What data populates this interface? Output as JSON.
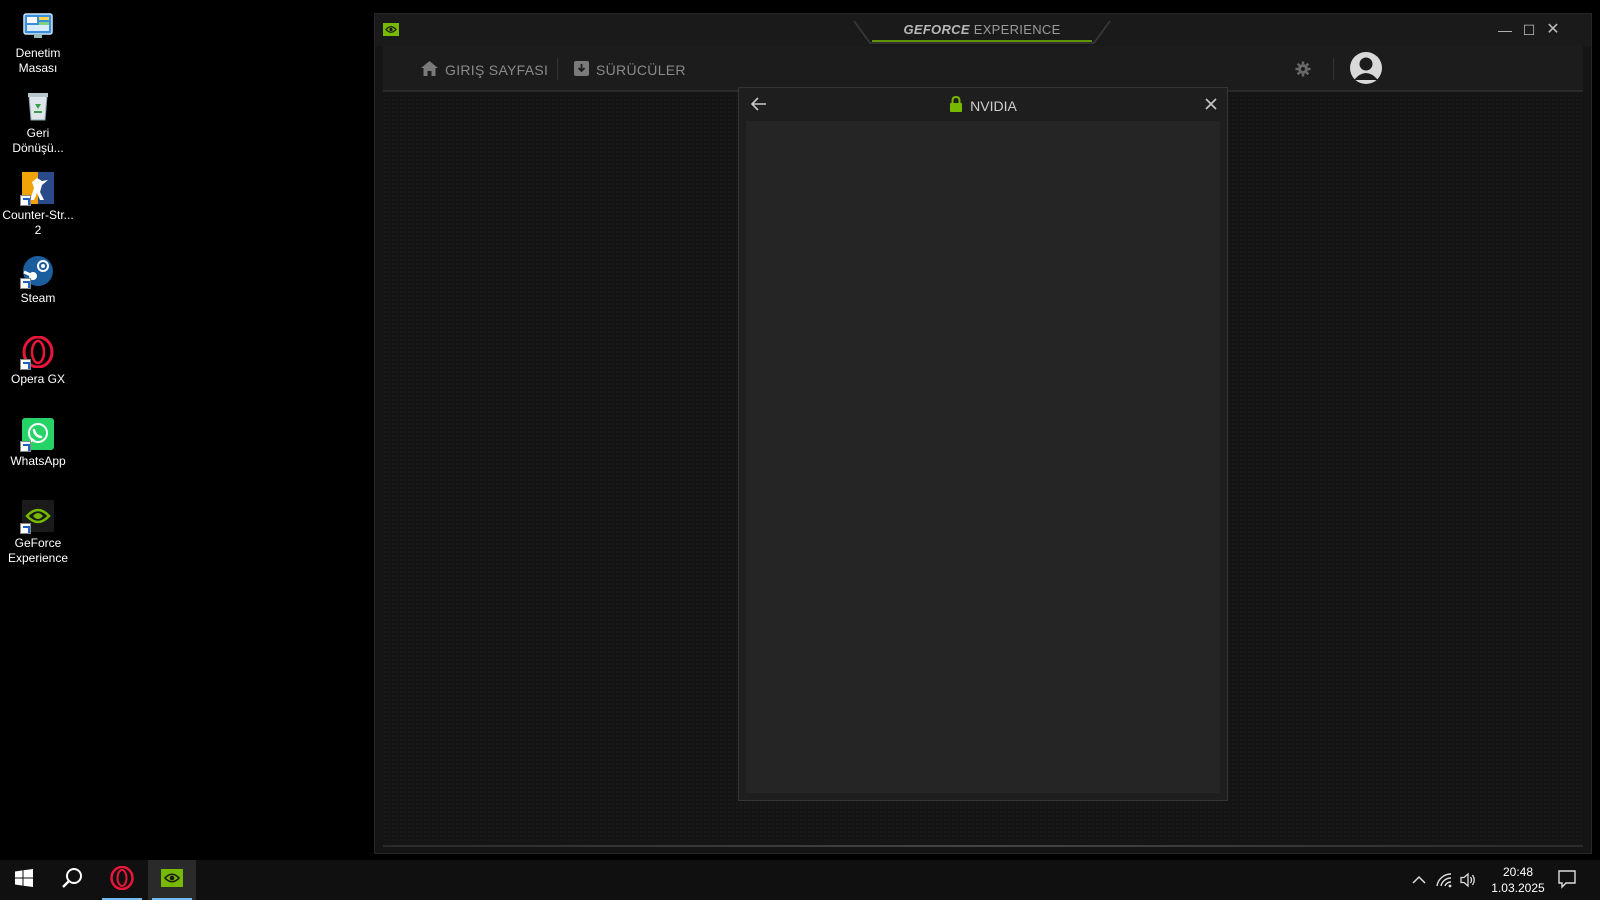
{
  "desktop": {
    "icons": [
      {
        "label": "Denetim\nMasası",
        "icon": "control-panel-icon"
      },
      {
        "label": "Geri\nDönüşü...",
        "icon": "recycle-bin-icon"
      },
      {
        "label": "Counter-Str...\n2",
        "icon": "counter-strike-icon"
      },
      {
        "label": "Steam",
        "icon": "steam-icon"
      },
      {
        "label": "Opera GX",
        "icon": "opera-gx-icon"
      },
      {
        "label": "WhatsApp",
        "icon": "whatsapp-icon"
      },
      {
        "label": "GeForce\nExperience",
        "icon": "geforce-experience-icon"
      }
    ]
  },
  "window": {
    "brand_bold": "GEFORCE",
    "brand_light": " EXPERIENCE",
    "nav": {
      "home_label": "GIRIŞ SAYFASI",
      "drivers_label": "SÜRÜCÜLER"
    }
  },
  "modal": {
    "title": "NVIDIA"
  },
  "taskbar": {
    "time": "20:48",
    "date": "1.03.2025"
  },
  "colors": {
    "nvidia_green": "#76b900",
    "opera_red": "#e8173a",
    "whatsapp_green": "#25d366"
  }
}
